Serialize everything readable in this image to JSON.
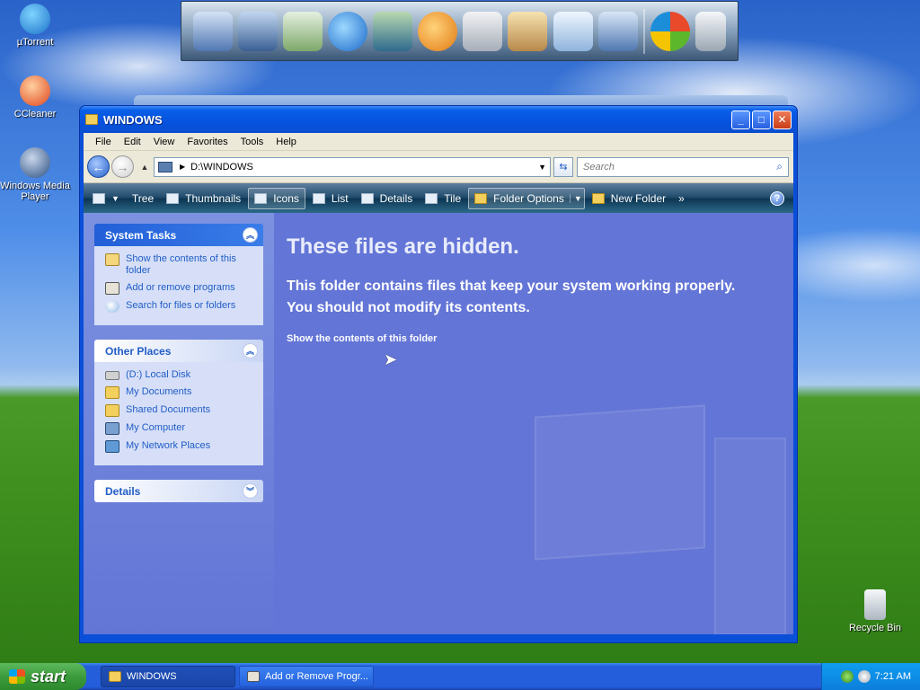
{
  "desktop": {
    "icons": [
      {
        "label": "µTorrent"
      },
      {
        "label": "CCleaner"
      },
      {
        "label": "Windows Media Player"
      },
      {
        "label": "Recycle Bin"
      }
    ]
  },
  "dock": {
    "items": [
      "my-computer-icon",
      "network-icon",
      "documents-icon",
      "internet-explorer-icon",
      "media-monitor-icon",
      "media-player-icon",
      "calculator-icon",
      "pencil-cup-icon",
      "notepad-icon",
      "control-panel-icon",
      "windows-logo-icon",
      "recycle-bin-icon"
    ]
  },
  "window": {
    "title": "WINDOWS",
    "menu": [
      "File",
      "Edit",
      "View",
      "Favorites",
      "Tools",
      "Help"
    ],
    "address": "D:\\WINDOWS",
    "search_placeholder": "Search",
    "toolbar": {
      "tree": "Tree",
      "thumbnails": "Thumbnails",
      "icons": "Icons",
      "list": "List",
      "details": "Details",
      "tile": "Tile",
      "folder_options": "Folder Options",
      "new_folder": "New Folder",
      "more": "»"
    },
    "sidebar": {
      "system_tasks": {
        "title": "System Tasks",
        "items": [
          "Show the contents of this folder",
          "Add or remove programs",
          "Search for files or folders"
        ]
      },
      "other_places": {
        "title": "Other Places",
        "items": [
          "(D:) Local Disk",
          "My Documents",
          "Shared Documents",
          "My Computer",
          "My Network Places"
        ]
      },
      "details": {
        "title": "Details"
      }
    },
    "main": {
      "heading": "These files are hidden.",
      "message_line1": "This folder contains files that keep your system working properly.",
      "message_line2": "You should not modify its contents.",
      "link": "Show the contents of this folder"
    }
  },
  "taskbar": {
    "start": "start",
    "tasks": [
      "WINDOWS",
      "Add or Remove Progr..."
    ],
    "clock": "7:21 AM"
  },
  "colors": {
    "accent": "#245edb",
    "content_bg": "#6375d6",
    "link": "#215dc6"
  }
}
